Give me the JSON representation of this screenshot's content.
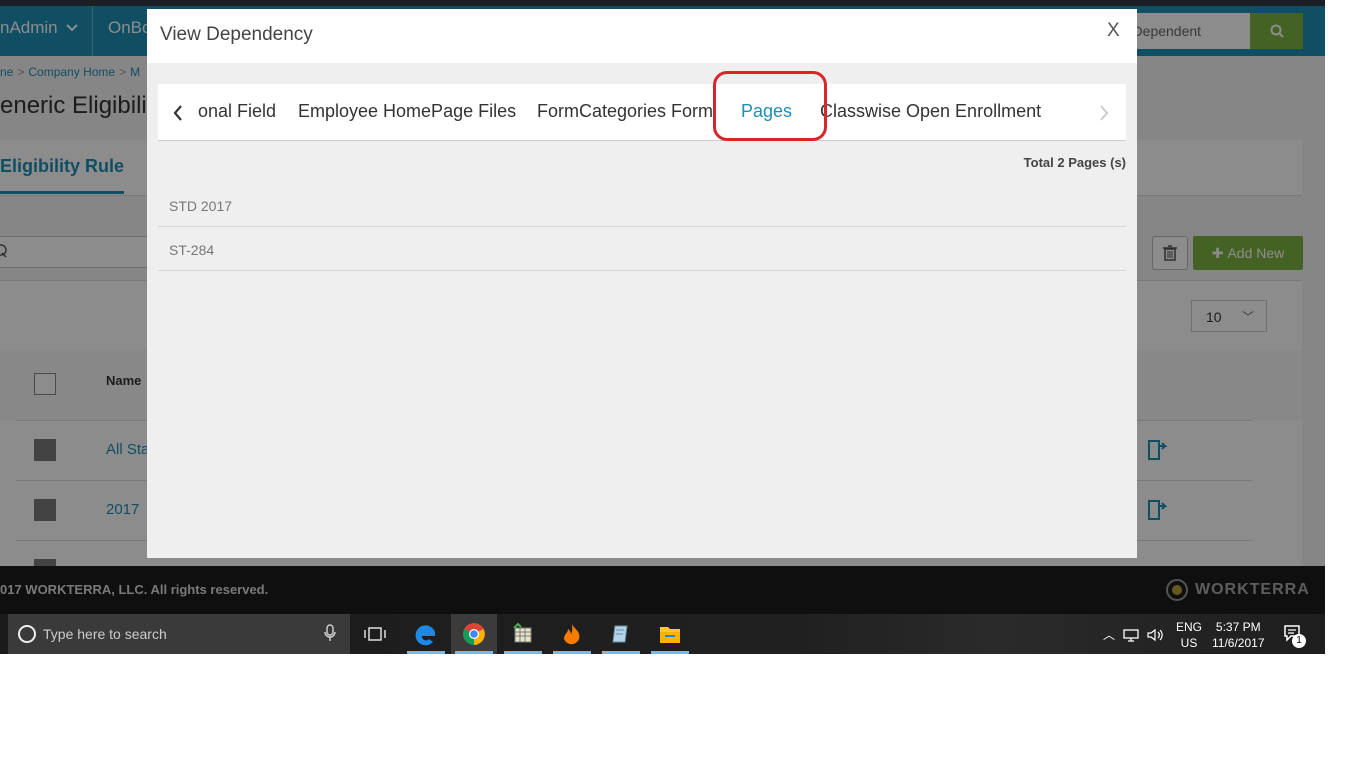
{
  "app": {
    "top_admin": "nAdmin",
    "top_onboarding": "OnBo",
    "top_search_placeholder": "r Dependent",
    "breadcrumb": [
      "ne",
      "Company Home",
      "M"
    ],
    "page_title": "eneric Eligibilit",
    "active_tab": "Eligibility Rule",
    "add_new": "Add New",
    "page_size": "10",
    "grid_header_name": "Name",
    "rows": [
      "All Sta",
      "2017 "
    ],
    "footer_text": "017 WORKTERRA, LLC. All rights reserved.",
    "footer_brand": "WORKTERRA"
  },
  "modal": {
    "title": "View Dependency",
    "close_label": "X",
    "tabs": [
      {
        "label": "onal Field"
      },
      {
        "label": "Employee HomePage Files"
      },
      {
        "label": "FormCategories Form"
      },
      {
        "label": "Pages"
      },
      {
        "label": "Classwise Open Enrollment"
      }
    ],
    "active_tab": "Pages",
    "total_label": "Total 2 Pages (s)",
    "items": [
      "STD 2017",
      "ST-284"
    ]
  },
  "taskbar": {
    "search_placeholder": "Type here to search",
    "lang_top": "ENG",
    "lang_bottom": "US",
    "time": "5:37 PM",
    "date": "11/6/2017",
    "notification_count": "1"
  },
  "colors": {
    "brand_blue": "#1e8fb6",
    "accent_green": "#7cb342",
    "highlight_red": "#d9262b"
  }
}
